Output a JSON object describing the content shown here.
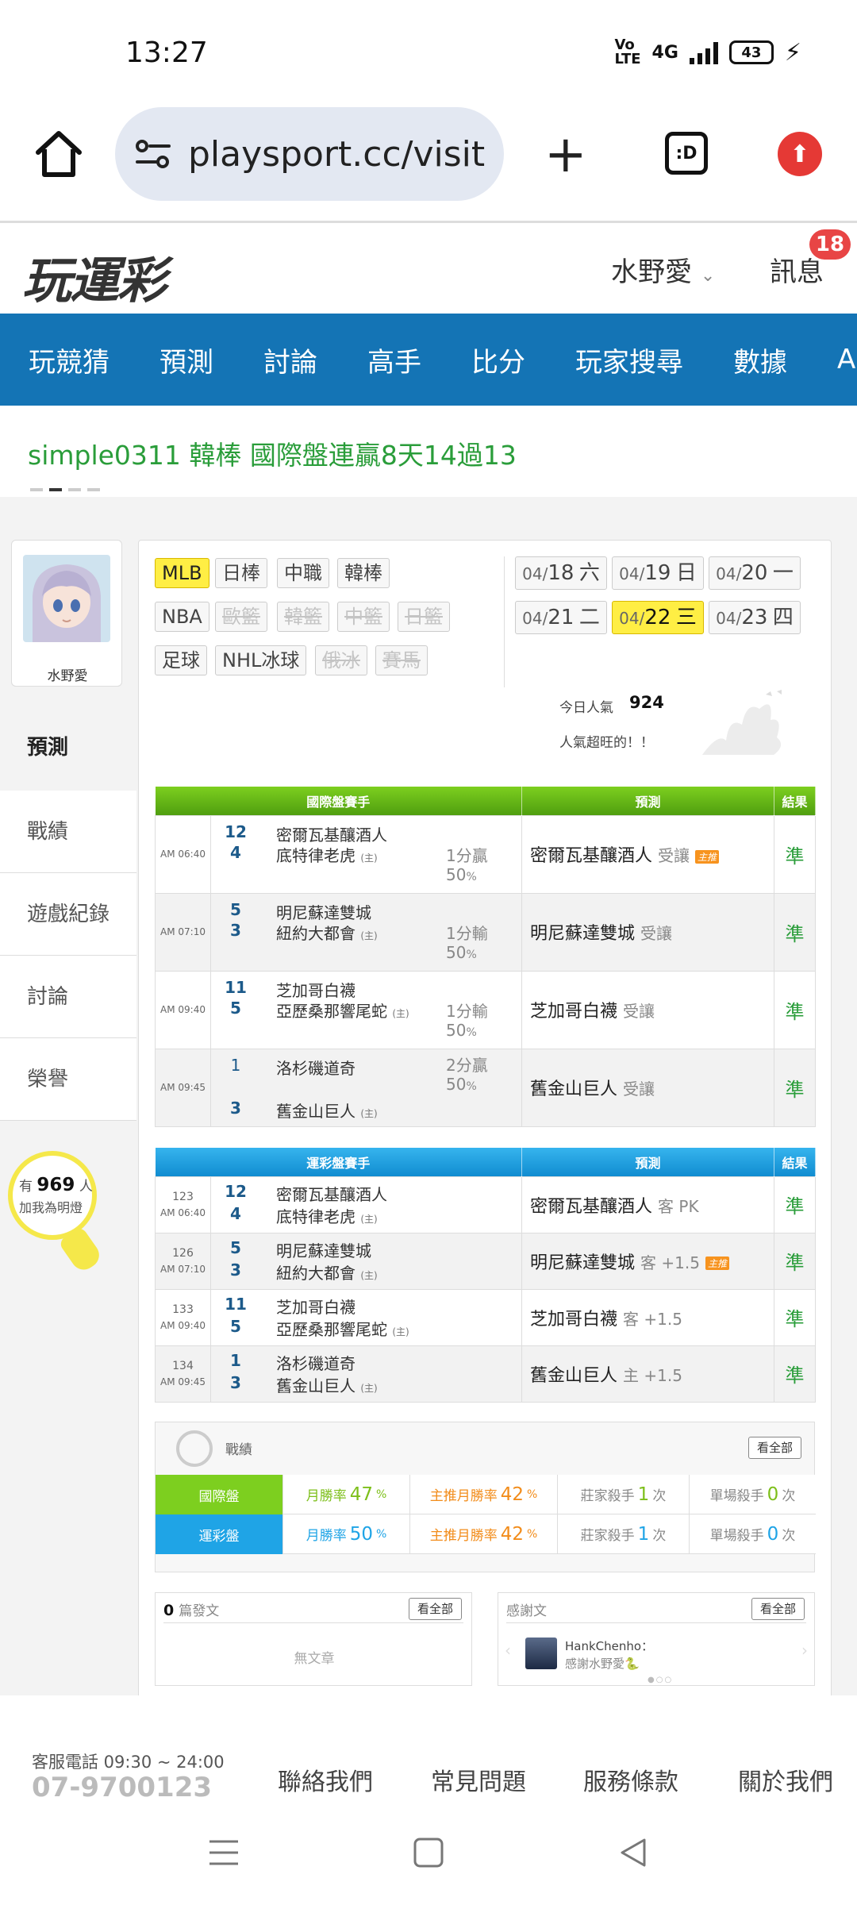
{
  "status": {
    "time": "13:27",
    "network": "4G",
    "battery": "43"
  },
  "browser": {
    "url": "playsport.cc/visit",
    "tab_label": ":D"
  },
  "site": {
    "logo": "玩運彩",
    "user": "水野愛",
    "messages_label": "訊息",
    "messages_count": "18"
  },
  "nav": [
    "玩競猜",
    "預測",
    "討論",
    "高手",
    "比分",
    "玩家搜尋",
    "數據",
    "APP"
  ],
  "marquee": {
    "text": "simple0311 韓棒 國際盤連贏8天14過13"
  },
  "sidebar": {
    "avatar_name": "水野愛",
    "items": [
      "預測",
      "戰績",
      "遊戲紀錄",
      "討論",
      "榮譽"
    ],
    "fans_prefix": "有",
    "fans_count": "969",
    "fans_suffix": "人",
    "fans_text": "加我為明燈"
  },
  "filters": {
    "leagues_row1": [
      {
        "label": "MLB",
        "state": "active"
      },
      {
        "label": "日棒",
        "state": "normal"
      },
      {
        "label": "中職",
        "state": "normal"
      },
      {
        "label": "韓棒",
        "state": "normal"
      }
    ],
    "leagues_row2": [
      {
        "label": "NBA",
        "state": "normal"
      },
      {
        "label": "歐籃",
        "state": "disabled"
      },
      {
        "label": "韓籃",
        "state": "disabled"
      },
      {
        "label": "中籃",
        "state": "disabled"
      },
      {
        "label": "日籃",
        "state": "disabled"
      }
    ],
    "leagues_row3": [
      {
        "label": "足球",
        "state": "normal"
      },
      {
        "label": "NHL冰球",
        "state": "normal"
      },
      {
        "label": "俄冰",
        "state": "disabled"
      },
      {
        "label": "賽馬",
        "state": "disabled"
      }
    ],
    "dates": [
      {
        "month": "04/",
        "day": "18",
        "weekday": "六",
        "active": false
      },
      {
        "month": "04/",
        "day": "19",
        "weekday": "日",
        "active": false
      },
      {
        "month": "04/",
        "day": "20",
        "weekday": "一",
        "active": false
      },
      {
        "month": "04/",
        "day": "21",
        "weekday": "二",
        "active": false
      },
      {
        "month": "04/",
        "day": "22",
        "weekday": "三",
        "active": true
      },
      {
        "month": "04/",
        "day": "23",
        "weekday": "四",
        "active": false
      }
    ],
    "popularity_label": "今日人氣",
    "popularity_value": "924",
    "popularity_note": "人氣超旺的！！"
  },
  "intl_table": {
    "headers": [
      "國際盤賽手",
      "預測",
      "結果"
    ],
    "rows": [
      {
        "time": "AM 06:40",
        "away_score": "12",
        "home_score": "4",
        "away": "密爾瓦基釀酒人",
        "home": "底特律老虎",
        "home_mark": "(主)",
        "outcome": "1分贏",
        "pct": "50",
        "pct_unit": "%",
        "pick": "密爾瓦基釀酒人",
        "pick_type": "受讓",
        "main_push": "主推",
        "result": "準"
      },
      {
        "time": "AM 07:10",
        "away_score": "5",
        "home_score": "3",
        "away": "明尼蘇達雙城",
        "home": "紐約大都會",
        "home_mark": "(主)",
        "outcome": "1分輸",
        "pct": "50",
        "pct_unit": "%",
        "pick": "明尼蘇達雙城",
        "pick_type": "受讓",
        "main_push": "",
        "result": "準"
      },
      {
        "time": "AM 09:40",
        "away_score": "11",
        "home_score": "5",
        "away": "芝加哥白襪",
        "home": "亞歷桑那響尾蛇",
        "home_mark": "(主)",
        "outcome": "1分輸",
        "pct": "50",
        "pct_unit": "%",
        "pick": "芝加哥白襪",
        "pick_type": "受讓",
        "main_push": "",
        "result": "準"
      },
      {
        "time": "AM 09:45",
        "away_score": "1",
        "home_score": "3",
        "away": "洛杉磯道奇",
        "home": "舊金山巨人",
        "home_mark": "(主)",
        "outcome": "2分贏",
        "pct": "50",
        "pct_unit": "%",
        "pick": "舊金山巨人",
        "pick_type": "受讓",
        "main_push": "",
        "result": "準"
      }
    ]
  },
  "lottery_table": {
    "headers": [
      "運彩盤賽手",
      "預測",
      "結果"
    ],
    "rows": [
      {
        "num": "123",
        "time": "AM 06:40",
        "away_score": "12",
        "home_score": "4",
        "away": "密爾瓦基釀酒人",
        "home": "底特律老虎",
        "home_mark": "(主)",
        "pick": "密爾瓦基釀酒人",
        "pick_type": "客 PK",
        "main_push": "",
        "result": "準"
      },
      {
        "num": "126",
        "time": "AM 07:10",
        "away_score": "5",
        "home_score": "3",
        "away": "明尼蘇達雙城",
        "home": "紐約大都會",
        "home_mark": "(主)",
        "pick": "明尼蘇達雙城",
        "pick_type": "客 +1.5",
        "main_push": "主推",
        "result": "準"
      },
      {
        "num": "133",
        "time": "AM 09:40",
        "away_score": "11",
        "home_score": "5",
        "away": "芝加哥白襪",
        "home": "亞歷桑那響尾蛇",
        "home_mark": "(主)",
        "pick": "芝加哥白襪",
        "pick_type": "客 +1.5",
        "main_push": "",
        "result": "準"
      },
      {
        "num": "134",
        "time": "AM 09:45",
        "away_score": "1",
        "home_score": "3",
        "away": "洛杉磯道奇",
        "home": "舊金山巨人",
        "home_mark": "(主)",
        "pick": "舊金山巨人",
        "pick_type": "主 +1.5",
        "main_push": "",
        "result": "準"
      }
    ]
  },
  "record": {
    "title": "戰績",
    "view_all": "看全部",
    "rows": [
      {
        "label": "國際盤",
        "monthly_label": "月勝率",
        "monthly": "47",
        "main_label": "主推月勝率",
        "main": "42",
        "unit": "%",
        "banker_label": "莊家殺手",
        "banker": "1",
        "single_label": "單場殺手",
        "single": "0",
        "count_unit": "次"
      },
      {
        "label": "運彩盤",
        "monthly_label": "月勝率",
        "monthly": "50",
        "main_label": "主推月勝率",
        "main": "42",
        "unit": "%",
        "banker_label": "莊家殺手",
        "banker": "1",
        "single_label": "單場殺手",
        "single": "0",
        "count_unit": "次"
      }
    ]
  },
  "articles": {
    "count": "0",
    "label": "篇發文",
    "view_all": "看全部",
    "empty": "無文章"
  },
  "thanks": {
    "label": "感謝文",
    "view_all": "看全部",
    "user": "HankChenho：",
    "message": "感謝水野愛🐍"
  },
  "footer": {
    "hotline_label": "客服電話 09:30 ~ 24:00",
    "hotline": "07-9700123",
    "links": [
      "聯絡我們",
      "常見問題",
      "服務條款",
      "關於我們"
    ]
  },
  "colors": {
    "nav_blue": "#1474b5",
    "accent_green": "#2a9d3a",
    "highlight_yellow": "#ffee44",
    "badge_red": "#e84545"
  }
}
